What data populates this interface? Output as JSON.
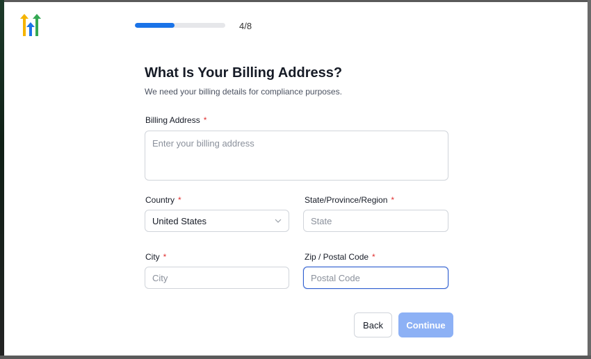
{
  "progress": {
    "step_text": "4/8",
    "fraction": 0.5,
    "color": "#1a73e8"
  },
  "header": {
    "title": "What Is Your Billing Address?",
    "subtitle": "We need your billing details for compliance purposes."
  },
  "form": {
    "billing_address": {
      "label": "Billing Address",
      "required": "*",
      "placeholder": "Enter your billing address",
      "value": ""
    },
    "country": {
      "label": "Country",
      "required": "*",
      "value": "United States"
    },
    "state": {
      "label": "State/Province/Region",
      "required": "*",
      "placeholder": "State",
      "value": ""
    },
    "city": {
      "label": "City",
      "required": "*",
      "placeholder": "City",
      "value": ""
    },
    "zip": {
      "label": "Zip / Postal Code",
      "required": "*",
      "placeholder": "Postal Code",
      "value": ""
    }
  },
  "buttons": {
    "back": "Back",
    "continue": "Continue"
  },
  "colors": {
    "accent": "#1a73e8",
    "continue_disabled": "#8db1f5",
    "required": "#e03131"
  },
  "icons": {
    "logo": "gohighlevel-arrows-logo",
    "select": "chevron-down-icon"
  }
}
